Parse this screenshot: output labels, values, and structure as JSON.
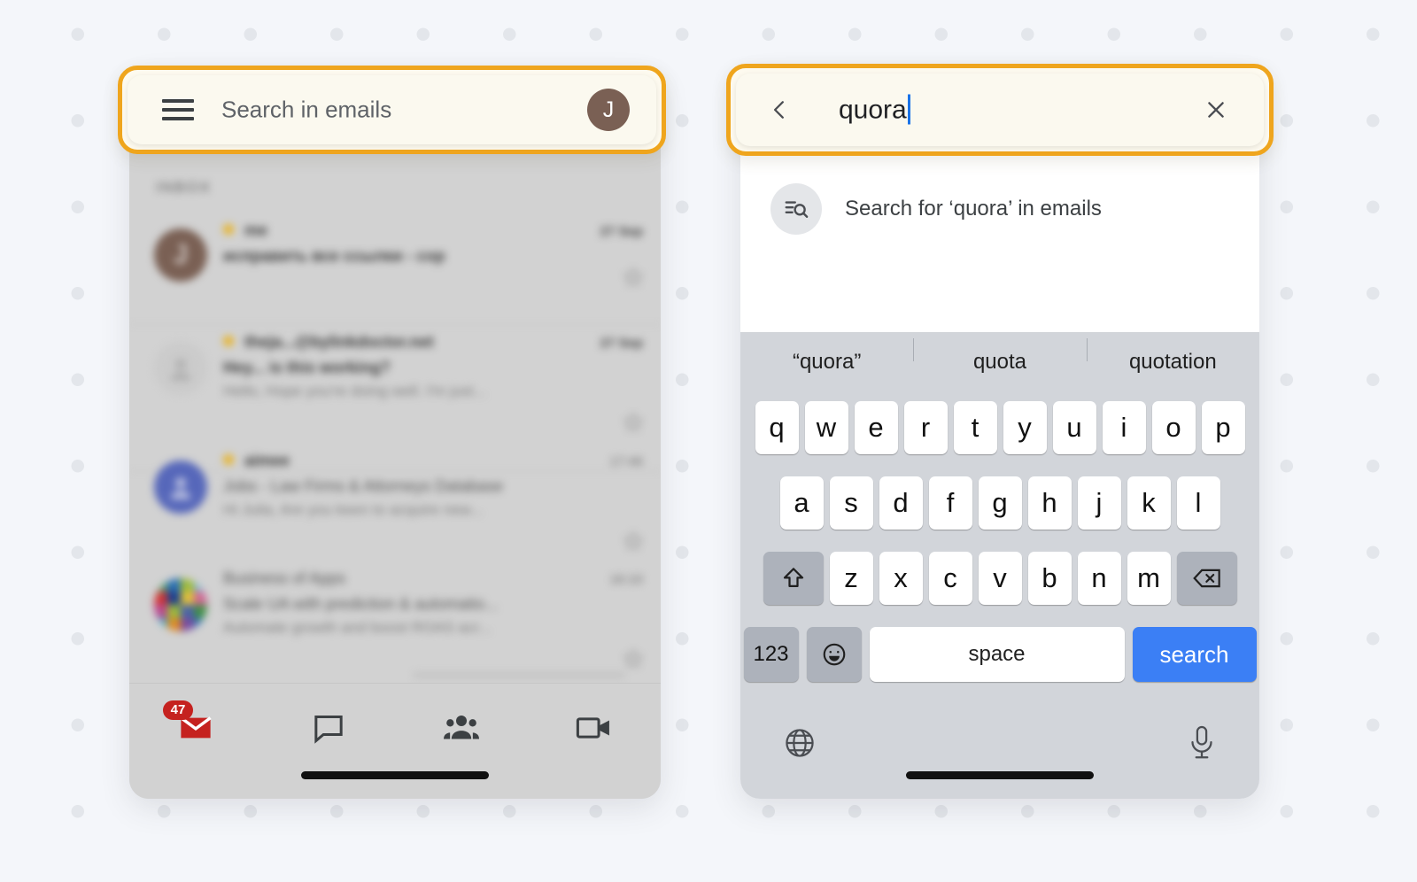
{
  "left_phone": {
    "search_bar": {
      "menu_icon": "hamburger-menu-icon",
      "placeholder": "Search in emails",
      "avatar_initial": "J"
    },
    "section_label": "INBOX",
    "emails": [
      {
        "avatar_type": "initial",
        "avatar_initial": "J",
        "avatar_color": "#7a6054",
        "unread": true,
        "sender": "me",
        "subject": "исправить все ссылки - сор",
        "snippet": "",
        "date": "27 Sep",
        "starred": false
      },
      {
        "avatar_type": "silhouette",
        "avatar_color": "#cbcbcb",
        "unread": true,
        "sender": "theja...@bylinkdoctor.net",
        "subject": "Hey... is this working?",
        "snippet": "Hello, Hope you're doing well. I'm just...",
        "date": "27 Sep",
        "starred": false
      },
      {
        "avatar_type": "silhouette",
        "avatar_color": "#5667ba",
        "unread": true,
        "sender": "aimee",
        "subject": "Jobs - Law Firms & Attorneys Database",
        "snippet": "Hi Julia, Are you keen to acquire new...",
        "date": "17:46",
        "starred": false
      },
      {
        "avatar_type": "grid",
        "unread": false,
        "sender": "Business of Apps",
        "subject": "Scale UA with prediction & automatio...",
        "snippet": "Automate growth and boost ROAS acr...",
        "date": "16:10",
        "starred": false
      }
    ],
    "bottom_nav": [
      {
        "icon": "mail-icon",
        "badge": "47",
        "active": true
      },
      {
        "icon": "chat-bubble-icon",
        "badge": "",
        "active": false
      },
      {
        "icon": "people-group-icon",
        "badge": "",
        "active": false
      },
      {
        "icon": "video-camera-icon",
        "badge": "",
        "active": false
      }
    ]
  },
  "right_phone": {
    "search_bar": {
      "back_icon": "back-chevron-icon",
      "query": "quora",
      "clear_icon": "close-x-icon"
    },
    "suggestion": {
      "icon": "search-in-emails-icon",
      "text": "Search for ‘quora’ in emails"
    },
    "keyboard": {
      "suggestions": [
        "“quora”",
        "quota",
        "quotation"
      ],
      "row1": [
        "q",
        "w",
        "e",
        "r",
        "t",
        "y",
        "u",
        "i",
        "o",
        "p"
      ],
      "row2": [
        "a",
        "s",
        "d",
        "f",
        "g",
        "h",
        "j",
        "k",
        "l"
      ],
      "row3_shift": "shift-icon",
      "row3": [
        "z",
        "x",
        "c",
        "v",
        "b",
        "n",
        "m"
      ],
      "row3_backspace": "backspace-icon",
      "numbers_key": "123",
      "emoji_key": "emoji-icon",
      "space_key": "space",
      "search_key": "search",
      "globe_key": "globe-icon",
      "mic_key": "microphone-icon"
    }
  },
  "colors": {
    "highlight_border": "#efa51d",
    "highlight_fill": "#fbf9ef",
    "accent_blue": "#3b7ff5",
    "badge_red": "#c5221f",
    "avatar_brown": "#7a6054",
    "caret_blue": "#1a73e8",
    "page_background": "#f4f6fa"
  }
}
